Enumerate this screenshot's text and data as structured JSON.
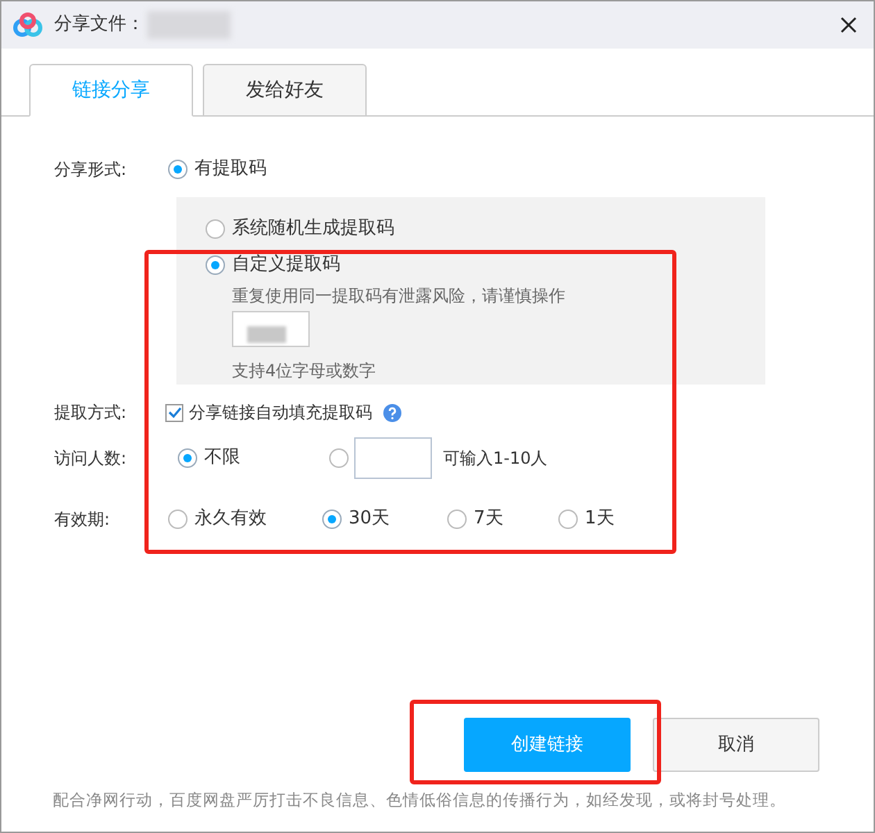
{
  "window": {
    "title": "分享文件："
  },
  "tabs": [
    {
      "label": "链接分享",
      "selected": true
    },
    {
      "label": "发给好友",
      "selected": false
    }
  ],
  "share_form": {
    "label": "分享形式:",
    "options": [
      {
        "label": "有提取码",
        "selected": true
      }
    ]
  },
  "code_panel": {
    "options": [
      {
        "label": "系统随机生成提取码",
        "selected": false
      },
      {
        "label": "自定义提取码",
        "selected": true
      }
    ],
    "warning": "重复使用同一提取码有泄露风险，请谨慎操作",
    "hint": "支持4位字母或数字"
  },
  "extract_method": {
    "label": "提取方式:",
    "checkbox_label": "分享链接自动填充提取码",
    "checked": true
  },
  "visitors": {
    "label": "访问人数:",
    "options": [
      {
        "label": "不限",
        "selected": true
      },
      {
        "selected": false
      }
    ],
    "hint": "可输入1-10人"
  },
  "validity": {
    "label": "有效期:",
    "options": [
      {
        "label": "永久有效",
        "selected": false
      },
      {
        "label": "30天",
        "selected": true
      },
      {
        "label": "7天",
        "selected": false
      },
      {
        "label": "1天",
        "selected": false
      }
    ]
  },
  "buttons": {
    "primary": "创建链接",
    "secondary": "取消"
  },
  "footer": "配合净网行动，百度网盘严厉打击不良信息、色情低俗信息的传播行为，如经发现，或将封号处理。"
}
